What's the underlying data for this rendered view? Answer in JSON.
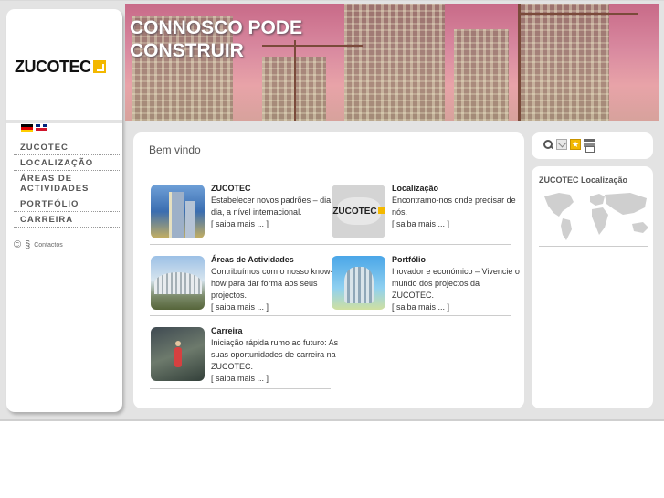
{
  "header": {
    "title_line1": "CONNOSCO PODE",
    "title_line2": "CONSTRUIR"
  },
  "sidebar": {
    "logo_text": "ZUCOTEC",
    "languages": [
      "de-flag-icon",
      "en-flag-icon"
    ],
    "nav": [
      {
        "label": "ZUCOTEC"
      },
      {
        "label": "LOCALIZAÇÃO"
      },
      {
        "label": "ÁREAS DE ACTIVIDADES"
      },
      {
        "label": "PORTFÓLIO"
      },
      {
        "label": "CARREIRA"
      }
    ],
    "footer": {
      "copyright": "©",
      "section": "§",
      "contacts": "Contactos"
    }
  },
  "main": {
    "welcome": "Bem vindo",
    "cards": [
      {
        "title": "ZUCOTEC",
        "desc": "Estabelecer novos padrões – dia a dia, a nível internacional.",
        "more": "[ saiba mais ... ]"
      },
      {
        "title": "Localização",
        "desc": "Encontramo-nos onde precisar de nós.",
        "more": "[ saiba mais ... ]",
        "thumb_text": "ZUCOTEC"
      },
      {
        "title": "Áreas de Actividades",
        "desc": "Contribuímos com o nosso know-how para dar forma aos seus projectos.",
        "more": "[ saiba mais ... ]"
      },
      {
        "title": "Portfólio",
        "desc": "Inovador e económico – Vivencie o mundo dos projectos da ZUCOTEC.",
        "more": "[ saiba mais ... ]"
      },
      {
        "title": "Carreira",
        "desc": "Iniciação rápida rumo ao futuro: As suas oportunidades de carreira na ZUCOTEC.",
        "more": "[ saiba mais ... ]"
      }
    ]
  },
  "tools": [
    "search-icon",
    "mail-icon",
    "bookmark-icon",
    "print-icon"
  ],
  "location_panel": {
    "title": "ZUCOTEC Localização"
  },
  "colors": {
    "brand_yellow": "#f3b800",
    "panel_bg": "#ffffff",
    "page_bg": "#e3e3e3"
  }
}
